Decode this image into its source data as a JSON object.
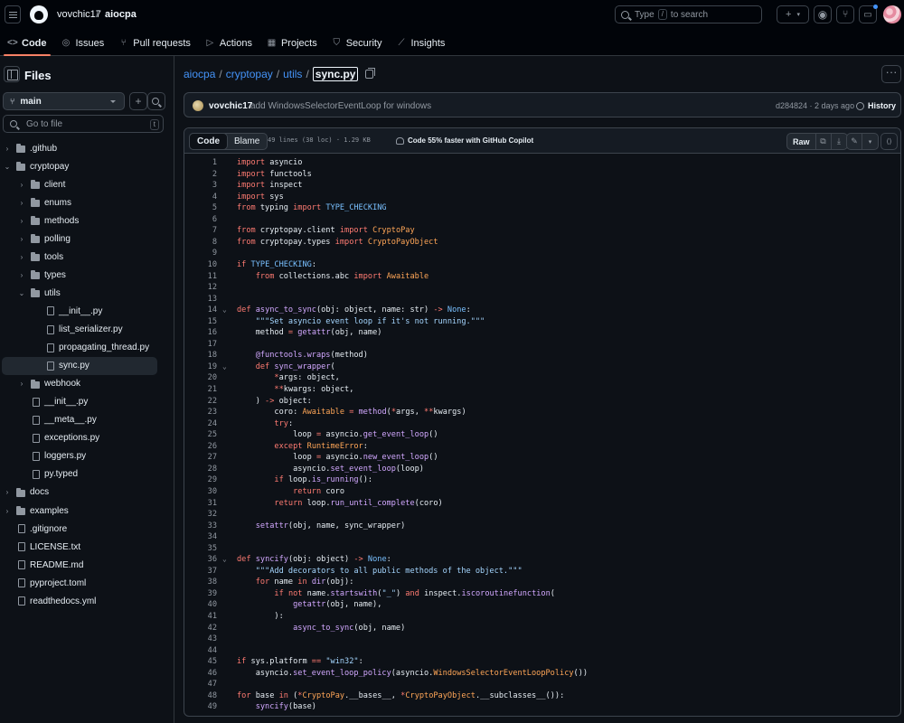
{
  "header": {
    "owner": "vovchic17",
    "separator": "/",
    "repo": "aiocpa",
    "search_prefix": "Type",
    "search_key": "/",
    "search_suffix": "to search"
  },
  "nav": [
    {
      "label": "Code",
      "icon": "code-icon",
      "glyph": "<>",
      "active": true
    },
    {
      "label": "Issues",
      "icon": "issue-icon",
      "glyph": "◎",
      "active": false
    },
    {
      "label": "Pull requests",
      "icon": "pull-request-icon",
      "glyph": "⑂",
      "active": false
    },
    {
      "label": "Actions",
      "icon": "play-icon",
      "glyph": "▷",
      "active": false
    },
    {
      "label": "Projects",
      "icon": "table-icon",
      "glyph": "▦",
      "active": false
    },
    {
      "label": "Security",
      "icon": "shield-icon",
      "glyph": "⛉",
      "active": false
    },
    {
      "label": "Insights",
      "icon": "graph-icon",
      "glyph": "⟋",
      "active": false
    }
  ],
  "sidebar": {
    "title": "Files",
    "branch": "main",
    "goto_placeholder": "Go to file",
    "goto_key": "t",
    "tree": [
      {
        "name": ".github",
        "type": "folder",
        "depth": 0,
        "open": false
      },
      {
        "name": "cryptopay",
        "type": "folder",
        "depth": 0,
        "open": true
      },
      {
        "name": "client",
        "type": "folder",
        "depth": 1,
        "open": false
      },
      {
        "name": "enums",
        "type": "folder",
        "depth": 1,
        "open": false
      },
      {
        "name": "methods",
        "type": "folder",
        "depth": 1,
        "open": false
      },
      {
        "name": "polling",
        "type": "folder",
        "depth": 1,
        "open": false
      },
      {
        "name": "tools",
        "type": "folder",
        "depth": 1,
        "open": false
      },
      {
        "name": "types",
        "type": "folder",
        "depth": 1,
        "open": false
      },
      {
        "name": "utils",
        "type": "folder",
        "depth": 1,
        "open": true
      },
      {
        "name": "__init__.py",
        "type": "file",
        "depth": 2
      },
      {
        "name": "list_serializer.py",
        "type": "file",
        "depth": 2
      },
      {
        "name": "propagating_thread.py",
        "type": "file",
        "depth": 2
      },
      {
        "name": "sync.py",
        "type": "file",
        "depth": 2,
        "selected": true
      },
      {
        "name": "webhook",
        "type": "folder",
        "depth": 1,
        "open": false
      },
      {
        "name": "__init__.py",
        "type": "file",
        "depth": 1
      },
      {
        "name": "__meta__.py",
        "type": "file",
        "depth": 1
      },
      {
        "name": "exceptions.py",
        "type": "file",
        "depth": 1
      },
      {
        "name": "loggers.py",
        "type": "file",
        "depth": 1
      },
      {
        "name": "py.typed",
        "type": "file",
        "depth": 1
      },
      {
        "name": "docs",
        "type": "folder",
        "depth": 0,
        "open": false
      },
      {
        "name": "examples",
        "type": "folder",
        "depth": 0,
        "open": false
      },
      {
        "name": ".gitignore",
        "type": "file",
        "depth": 0
      },
      {
        "name": "LICENSE.txt",
        "type": "file",
        "depth": 0
      },
      {
        "name": "README.md",
        "type": "file",
        "depth": 0
      },
      {
        "name": "pyproject.toml",
        "type": "file",
        "depth": 0
      },
      {
        "name": "readthedocs.yml",
        "type": "file",
        "depth": 0
      }
    ]
  },
  "path": {
    "parts": [
      "aiocpa",
      "cryptopay",
      "utils"
    ],
    "separator": "/",
    "current": "sync.py"
  },
  "commit": {
    "author": "vovchic17",
    "message": "add WindowsSelectorEventLoop for windows",
    "meta": "d284824 · 2 days ago",
    "history_label": "History"
  },
  "code_toolbar": {
    "tab_code": "Code",
    "tab_blame": "Blame",
    "file_info": "49 lines (38 loc) · 1.29 KB",
    "copilot": "Code 55% faster with GitHub Copilot",
    "raw_label": "Raw"
  },
  "code_lines": [
    {
      "n": "1",
      "fold": "",
      "html": "<span class='k'>import</span> asyncio"
    },
    {
      "n": "2",
      "fold": "",
      "html": "<span class='k'>import</span> functools"
    },
    {
      "n": "3",
      "fold": "",
      "html": "<span class='k'>import</span> inspect"
    },
    {
      "n": "4",
      "fold": "",
      "html": "<span class='k'>import</span> sys"
    },
    {
      "n": "5",
      "fold": "",
      "html": "<span class='k'>from</span> typing <span class='k'>import</span> <span class='c'>TYPE_CHECKING</span>"
    },
    {
      "n": "6",
      "fold": "",
      "html": ""
    },
    {
      "n": "7",
      "fold": "",
      "html": "<span class='k'>from</span> cryptopay.client <span class='k'>import</span> <span class='o'>CryptoPay</span>"
    },
    {
      "n": "8",
      "fold": "",
      "html": "<span class='k'>from</span> cryptopay.types <span class='k'>import</span> <span class='o'>CryptoPayObject</span>"
    },
    {
      "n": "9",
      "fold": "",
      "html": ""
    },
    {
      "n": "10",
      "fold": "",
      "html": "<span class='k'>if</span> <span class='c'>TYPE_CHECKING</span>:"
    },
    {
      "n": "11",
      "fold": "",
      "html": "    <span class='k'>from</span> collections.abc <span class='k'>import</span> <span class='o'>Awaitable</span>"
    },
    {
      "n": "12",
      "fold": "",
      "html": ""
    },
    {
      "n": "13",
      "fold": "",
      "html": ""
    },
    {
      "n": "14",
      "fold": "⌄",
      "html": "<span class='k'>def</span> <span class='f'>async_to_sync</span>(obj: object, name: str) <span class='k'>-&gt;</span> <span class='c'>None</span>:"
    },
    {
      "n": "15",
      "fold": "",
      "html": "    <span class='s'>\"\"\"Set asyncio event loop if it's not running.\"\"\"</span>"
    },
    {
      "n": "16",
      "fold": "",
      "html": "    method <span class='k'>=</span> <span class='f'>getattr</span>(obj, name)"
    },
    {
      "n": "17",
      "fold": "",
      "html": ""
    },
    {
      "n": "18",
      "fold": "",
      "html": "    <span class='f'>@functools.wraps</span>(method)"
    },
    {
      "n": "19",
      "fold": "⌄",
      "html": "    <span class='k'>def</span> <span class='f'>sync_wrapper</span>("
    },
    {
      "n": "20",
      "fold": "",
      "html": "        <span class='k'>*</span>args: object,"
    },
    {
      "n": "21",
      "fold": "",
      "html": "        <span class='k'>**</span>kwargs: object,"
    },
    {
      "n": "22",
      "fold": "",
      "html": "    ) <span class='k'>-&gt;</span> object:"
    },
    {
      "n": "23",
      "fold": "",
      "html": "        coro: <span class='o'>Awaitable</span> <span class='k'>=</span> <span class='f'>method</span>(<span class='k'>*</span>args, <span class='k'>**</span>kwargs)"
    },
    {
      "n": "24",
      "fold": "",
      "html": "        <span class='k'>try</span>:"
    },
    {
      "n": "25",
      "fold": "",
      "html": "            loop <span class='k'>=</span> asyncio.<span class='f'>get_event_loop</span>()"
    },
    {
      "n": "26",
      "fold": "",
      "html": "        <span class='k'>except</span> <span class='o'>RuntimeError</span>:"
    },
    {
      "n": "27",
      "fold": "",
      "html": "            loop <span class='k'>=</span> asyncio.<span class='f'>new_event_loop</span>()"
    },
    {
      "n": "28",
      "fold": "",
      "html": "            asyncio.<span class='f'>set_event_loop</span>(loop)"
    },
    {
      "n": "29",
      "fold": "",
      "html": "        <span class='k'>if</span> loop.<span class='f'>is_running</span>():"
    },
    {
      "n": "30",
      "fold": "",
      "html": "            <span class='k'>return</span> coro"
    },
    {
      "n": "31",
      "fold": "",
      "html": "        <span class='k'>return</span> loop.<span class='f'>run_until_complete</span>(coro)"
    },
    {
      "n": "32",
      "fold": "",
      "html": ""
    },
    {
      "n": "33",
      "fold": "",
      "html": "    <span class='f'>setattr</span>(obj, name, sync_wrapper)"
    },
    {
      "n": "34",
      "fold": "",
      "html": ""
    },
    {
      "n": "35",
      "fold": "",
      "html": ""
    },
    {
      "n": "36",
      "fold": "⌄",
      "html": "<span class='k'>def</span> <span class='f'>syncify</span>(obj: object) <span class='k'>-&gt;</span> <span class='c'>None</span>:"
    },
    {
      "n": "37",
      "fold": "",
      "html": "    <span class='s'>\"\"\"Add decorators to all public methods of the object.\"\"\"</span>"
    },
    {
      "n": "38",
      "fold": "",
      "html": "    <span class='k'>for</span> name <span class='k'>in</span> <span class='f'>dir</span>(obj):"
    },
    {
      "n": "39",
      "fold": "",
      "html": "        <span class='k'>if</span> <span class='k'>not</span> name.<span class='f'>startswith</span>(<span class='s'>\"_\"</span>) <span class='k'>and</span> inspect.<span class='f'>iscoroutinefunction</span>("
    },
    {
      "n": "40",
      "fold": "",
      "html": "            <span class='f'>getattr</span>(obj, name),"
    },
    {
      "n": "41",
      "fold": "",
      "html": "        ):"
    },
    {
      "n": "42",
      "fold": "",
      "html": "            <span class='f'>async_to_sync</span>(obj, name)"
    },
    {
      "n": "43",
      "fold": "",
      "html": ""
    },
    {
      "n": "44",
      "fold": "",
      "html": ""
    },
    {
      "n": "45",
      "fold": "",
      "html": "<span class='k'>if</span> sys.platform <span class='k'>==</span> <span class='s'>\"win32\"</span>:"
    },
    {
      "n": "46",
      "fold": "",
      "html": "    asyncio.<span class='f'>set_event_loop_policy</span>(asyncio.<span class='o'>WindowsSelectorEventLoopPolicy</span>())"
    },
    {
      "n": "47",
      "fold": "",
      "html": ""
    },
    {
      "n": "48",
      "fold": "",
      "html": "<span class='k'>for</span> base <span class='k'>in</span> (<span class='k'>*</span><span class='o'>CryptoPay</span>.__bases__, <span class='k'>*</span><span class='o'>CryptoPayObject</span>.__subclasses__()):"
    },
    {
      "n": "49",
      "fold": "",
      "html": "    <span class='f'>syncify</span>(base)"
    }
  ]
}
